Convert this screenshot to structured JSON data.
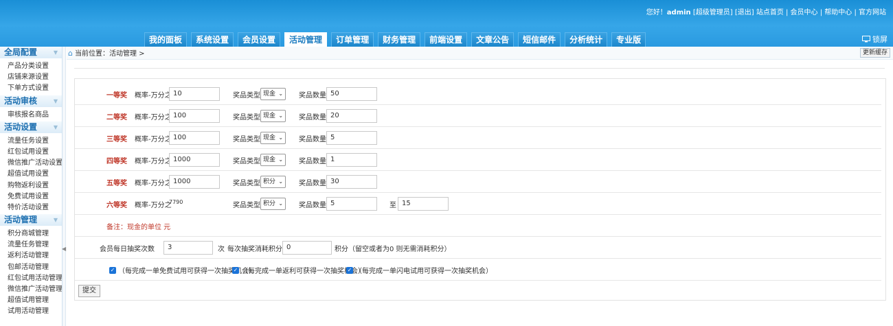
{
  "header": {
    "top_links": {
      "greeting": "您好！",
      "admin_name": "admin",
      "rest": " [超级管理员] [退出] 站点首页 | 会员中心 | 帮助中心 | 官方网站"
    },
    "tabs": [
      "我的面板",
      "系统设置",
      "会员设置",
      "活动管理",
      "订单管理",
      "财务管理",
      "前端设置",
      "文章公告",
      "短信邮件",
      "分析统计",
      "专业版"
    ],
    "active_tab": "活动管理",
    "lock_label": "锁屏"
  },
  "sidebar": {
    "groups": [
      {
        "title": "全局配置",
        "items": [
          "产品分类设置",
          "店铺来源设置",
          "下单方式设置"
        ]
      },
      {
        "title": "活动审核",
        "items": [
          "审核报名商品"
        ]
      },
      {
        "title": "活动设置",
        "items": [
          "流量任务设置",
          "红包试用设置",
          "微信推广活动设置",
          "超值试用设置",
          "购物返利设置",
          "免费试用设置",
          "特价活动设置"
        ]
      },
      {
        "title": "活动管理",
        "items": [
          "积分商城管理",
          "流量任务管理",
          "返利活动管理",
          "包邮活动管理",
          "红包试用活动管理",
          "微信推广活动管理",
          "超值试用管理",
          "试用活动管理"
        ]
      }
    ]
  },
  "breadcrumb": {
    "text": "当前位置：活动管理 >"
  },
  "refresh_label": "更新缓存",
  "form": {
    "prob_label": "概率-万分之",
    "type_label": "奖品类型",
    "qty_label": "奖品数量",
    "to_label": "至",
    "prizes": [
      {
        "name": "一等奖",
        "prob": "10",
        "type": "现金",
        "qty": "50"
      },
      {
        "name": "二等奖",
        "prob": "100",
        "type": "现金",
        "qty": "20"
      },
      {
        "name": "三等奖",
        "prob": "100",
        "type": "现金",
        "qty": "5"
      },
      {
        "name": "四等奖",
        "prob": "1000",
        "type": "现金",
        "qty": "1"
      },
      {
        "name": "五等奖",
        "prob": "1000",
        "type": "积分",
        "qty": "30"
      },
      {
        "name": "六等奖",
        "prob": "7790",
        "type": "积分",
        "qty": "5",
        "qty_max": "15"
      }
    ],
    "note": "备注：现金的单位 元",
    "daily_label": "会员每日抽奖次数",
    "daily_value": "3",
    "times_label": "次",
    "cost_label": "每次抽奖消耗积分",
    "cost_value": "0",
    "cost_hint": "积分（留空或者为0 则无需消耗积分）",
    "checkboxes": [
      "（每完成一单免费试用可获得一次抽奖机会）",
      "（每完成一单返利可获得一次抽奖机会）",
      "（每完成一单闪电试用可获得一次抽奖机会）"
    ],
    "submit_label": "提交"
  },
  "colors": {
    "header_blue": "#2a9ae0",
    "prize_red": "#c0392b",
    "checkbox_blue": "#1a73d8"
  }
}
